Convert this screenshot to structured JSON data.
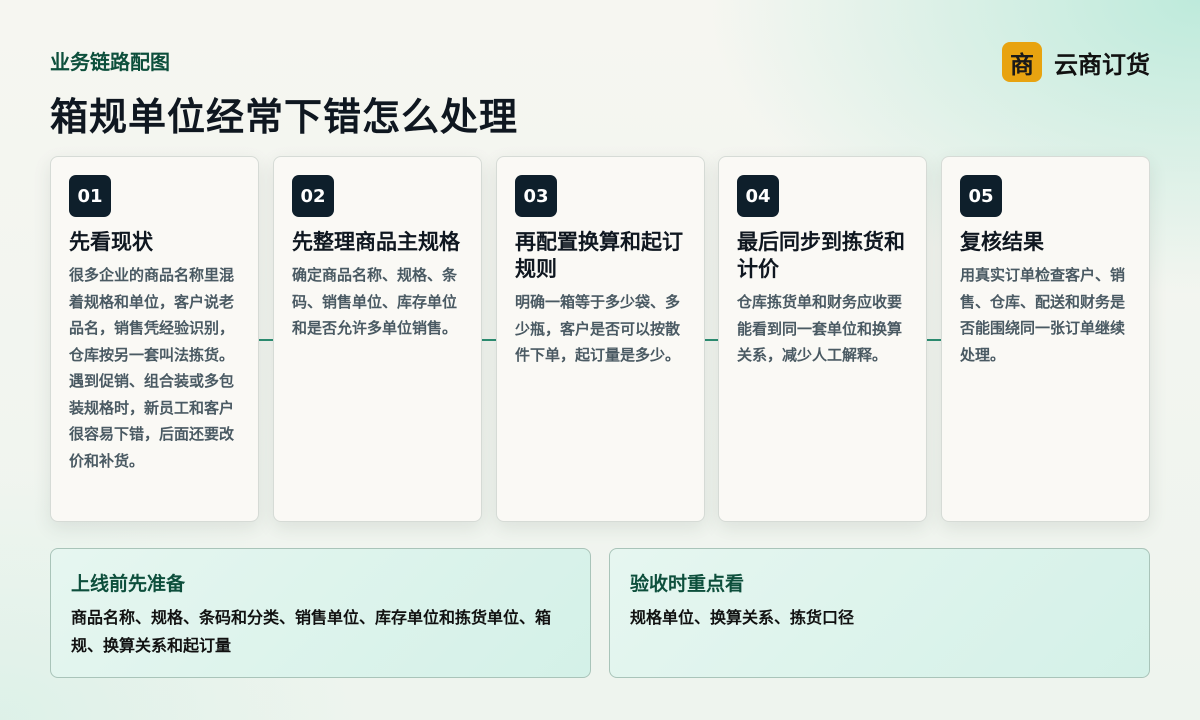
{
  "header": {
    "eyebrow": "业务链路配图",
    "title": "箱规单位经常下错怎么处理"
  },
  "brand": {
    "logo_char": "商",
    "name": "云商订货"
  },
  "steps": [
    {
      "number": "01",
      "title": "先看现状",
      "body": "很多企业的商品名称里混着规格和单位，客户说老品名，销售凭经验识别，仓库按另一套叫法拣货。遇到促销、组合装或多包装规格时，新员工和客户很容易下错，后面还要改价和补货。"
    },
    {
      "number": "02",
      "title": "先整理商品主规格",
      "body": "确定商品名称、规格、条码、销售单位、库存单位和是否允许多单位销售。"
    },
    {
      "number": "03",
      "title": "再配置换算和起订规则",
      "body": "明确一箱等于多少袋、多少瓶，客户是否可以按散件下单，起订量是多少。"
    },
    {
      "number": "04",
      "title": "最后同步到拣货和计价",
      "body": "仓库拣货单和财务应收要能看到同一套单位和换算关系，减少人工解释。"
    },
    {
      "number": "05",
      "title": "复核结果",
      "body": "用真实订单检查客户、销售、仓库、配送和财务是否能围绕同一张订单继续处理。"
    }
  ],
  "panels": [
    {
      "title": "上线前先准备",
      "body": "商品名称、规格、条码和分类、销售单位、库存单位和拣货单位、箱规、换算关系和起订量"
    },
    {
      "title": "验收时重点看",
      "body": "规格单位、换算关系、拣货口径"
    }
  ],
  "colors": {
    "accent": "#0d4f3c",
    "badge": "#0e1f2b",
    "brand_logo": "#e8a310",
    "connector": "#2d8f73"
  }
}
